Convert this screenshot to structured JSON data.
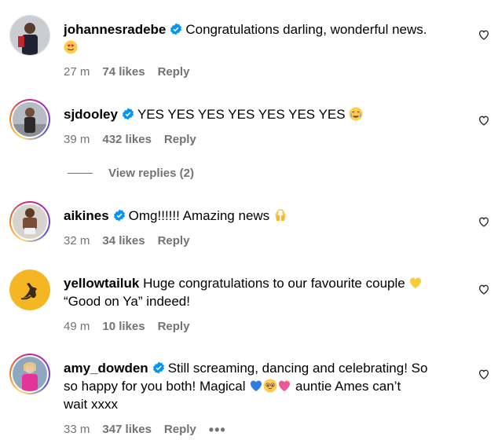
{
  "comments": [
    {
      "username": "johannesradebe",
      "verified": true,
      "text": "Congratulations darling, wonderful news.",
      "emoji": "heart-eyes-emoji",
      "time": "27 m",
      "likes": "74 likes",
      "reply": "Reply"
    },
    {
      "username": "sjdooley",
      "verified": true,
      "text": "YES YES YES YES YES YES YES",
      "emoji": "crying-emoji",
      "time": "39 m",
      "likes": "432 likes",
      "reply": "Reply",
      "view_replies": "View replies (2)"
    },
    {
      "username": "aikines",
      "verified": true,
      "text": "Omg!!!!!! Amazing news",
      "emoji": "raised-hands-emoji",
      "time": "32 m",
      "likes": "34 likes",
      "reply": "Reply"
    },
    {
      "username": "yellowtailuk",
      "verified": false,
      "text_line1": "Huge congratulations to our favourite couple",
      "emoji": "yellow-heart-emoji",
      "text_line2": "“Good on Ya” indeed!",
      "time": "49 m",
      "likes": "10 likes",
      "reply": "Reply"
    },
    {
      "username": "amy_dowden",
      "verified": true,
      "text_line1": "Still screaming, dancing and celebrating! So",
      "text_line2a": "so happy for you both! Magical",
      "text_line2b": "auntie Ames can’t",
      "text_line3": "wait xxxx",
      "time": "33 m",
      "likes": "347 likes",
      "reply": "Reply",
      "more": "•••"
    }
  ],
  "colors": {
    "verified": "#0095f6",
    "meta": "#737373",
    "text": "#000000"
  }
}
